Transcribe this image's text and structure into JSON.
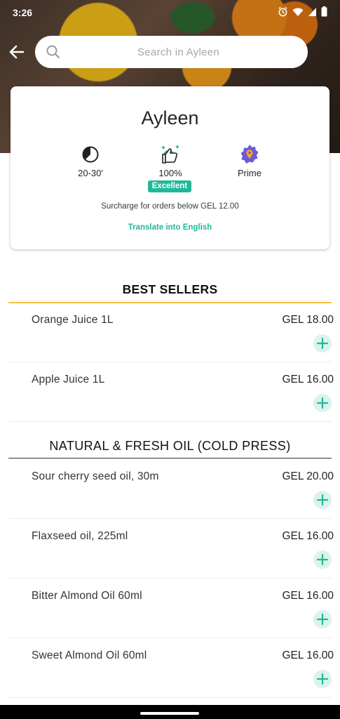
{
  "status_bar": {
    "time": "3:26"
  },
  "search": {
    "placeholder": "Search in Ayleen"
  },
  "store": {
    "name": "Ayleen",
    "delivery_time": "20-30'",
    "rating": "100%",
    "rating_badge": "Excellent",
    "tier": "Prime",
    "surcharge_text": "Surcharge for orders below GEL 12.00",
    "translate_label": "Translate into English"
  },
  "sections": [
    {
      "title": "BEST SELLERS",
      "items": [
        {
          "name": "Orange Juice 1L",
          "price": "GEL 18.00"
        },
        {
          "name": "Apple Juice 1L",
          "price": "GEL 16.00"
        }
      ]
    },
    {
      "title": "NATURAL & FRESH OIL (COLD PRESS)",
      "items": [
        {
          "name": "Sour cherry seed oil, 30m",
          "price": "GEL 20.00"
        },
        {
          "name": "Flaxseed oil, 225ml",
          "price": "GEL 16.00"
        },
        {
          "name": "Bitter Almond Oil 60ml",
          "price": "GEL 16.00"
        },
        {
          "name": "Sweet Almond Oil 60ml",
          "price": "GEL 16.00"
        }
      ]
    }
  ],
  "colors": {
    "accent": "#21b89a",
    "best_sellers_rule": "#f5c242",
    "prime": "#6a5bd6"
  }
}
